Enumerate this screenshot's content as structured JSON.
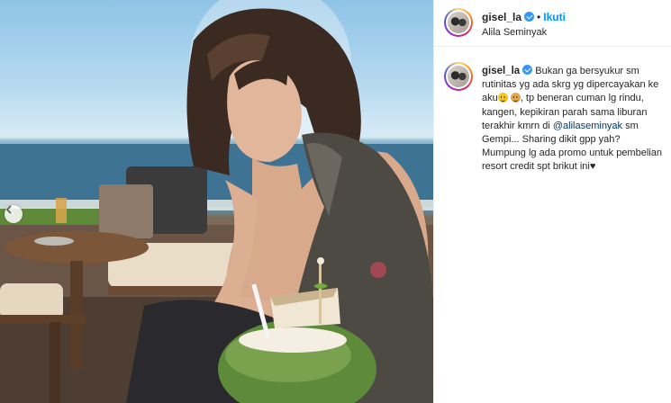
{
  "post": {
    "username": "gisel_la",
    "follow_label": "Ikuti",
    "separator": "•",
    "location": "Alila Seminyak"
  },
  "caption": {
    "username": "gisel_la",
    "text_part1": "Bukan ga bersyukur sm rutinitas yg ada skrg yg dipercayakan ke aku",
    "text_part2": ", tp beneran cuman lg rindu, kangen, kepikiran parah sama liburan terakhir kmrn di ",
    "mention": "@alilaseminyak",
    "text_part3": " sm Gempi... Sharing dikit gpp yah? Mumpung lg ada promo untuk pembelian resort credit spt brikut ini♥"
  },
  "icons": {
    "verified": "verified-badge-icon",
    "prev": "chevron-left-icon",
    "emoji1": "grinning-face-emoji",
    "emoji2": "see-no-evil-monkey-emoji"
  },
  "colors": {
    "link": "#0095f6",
    "mention": "#00376b",
    "verified": "#3897f0",
    "text": "#262626"
  }
}
